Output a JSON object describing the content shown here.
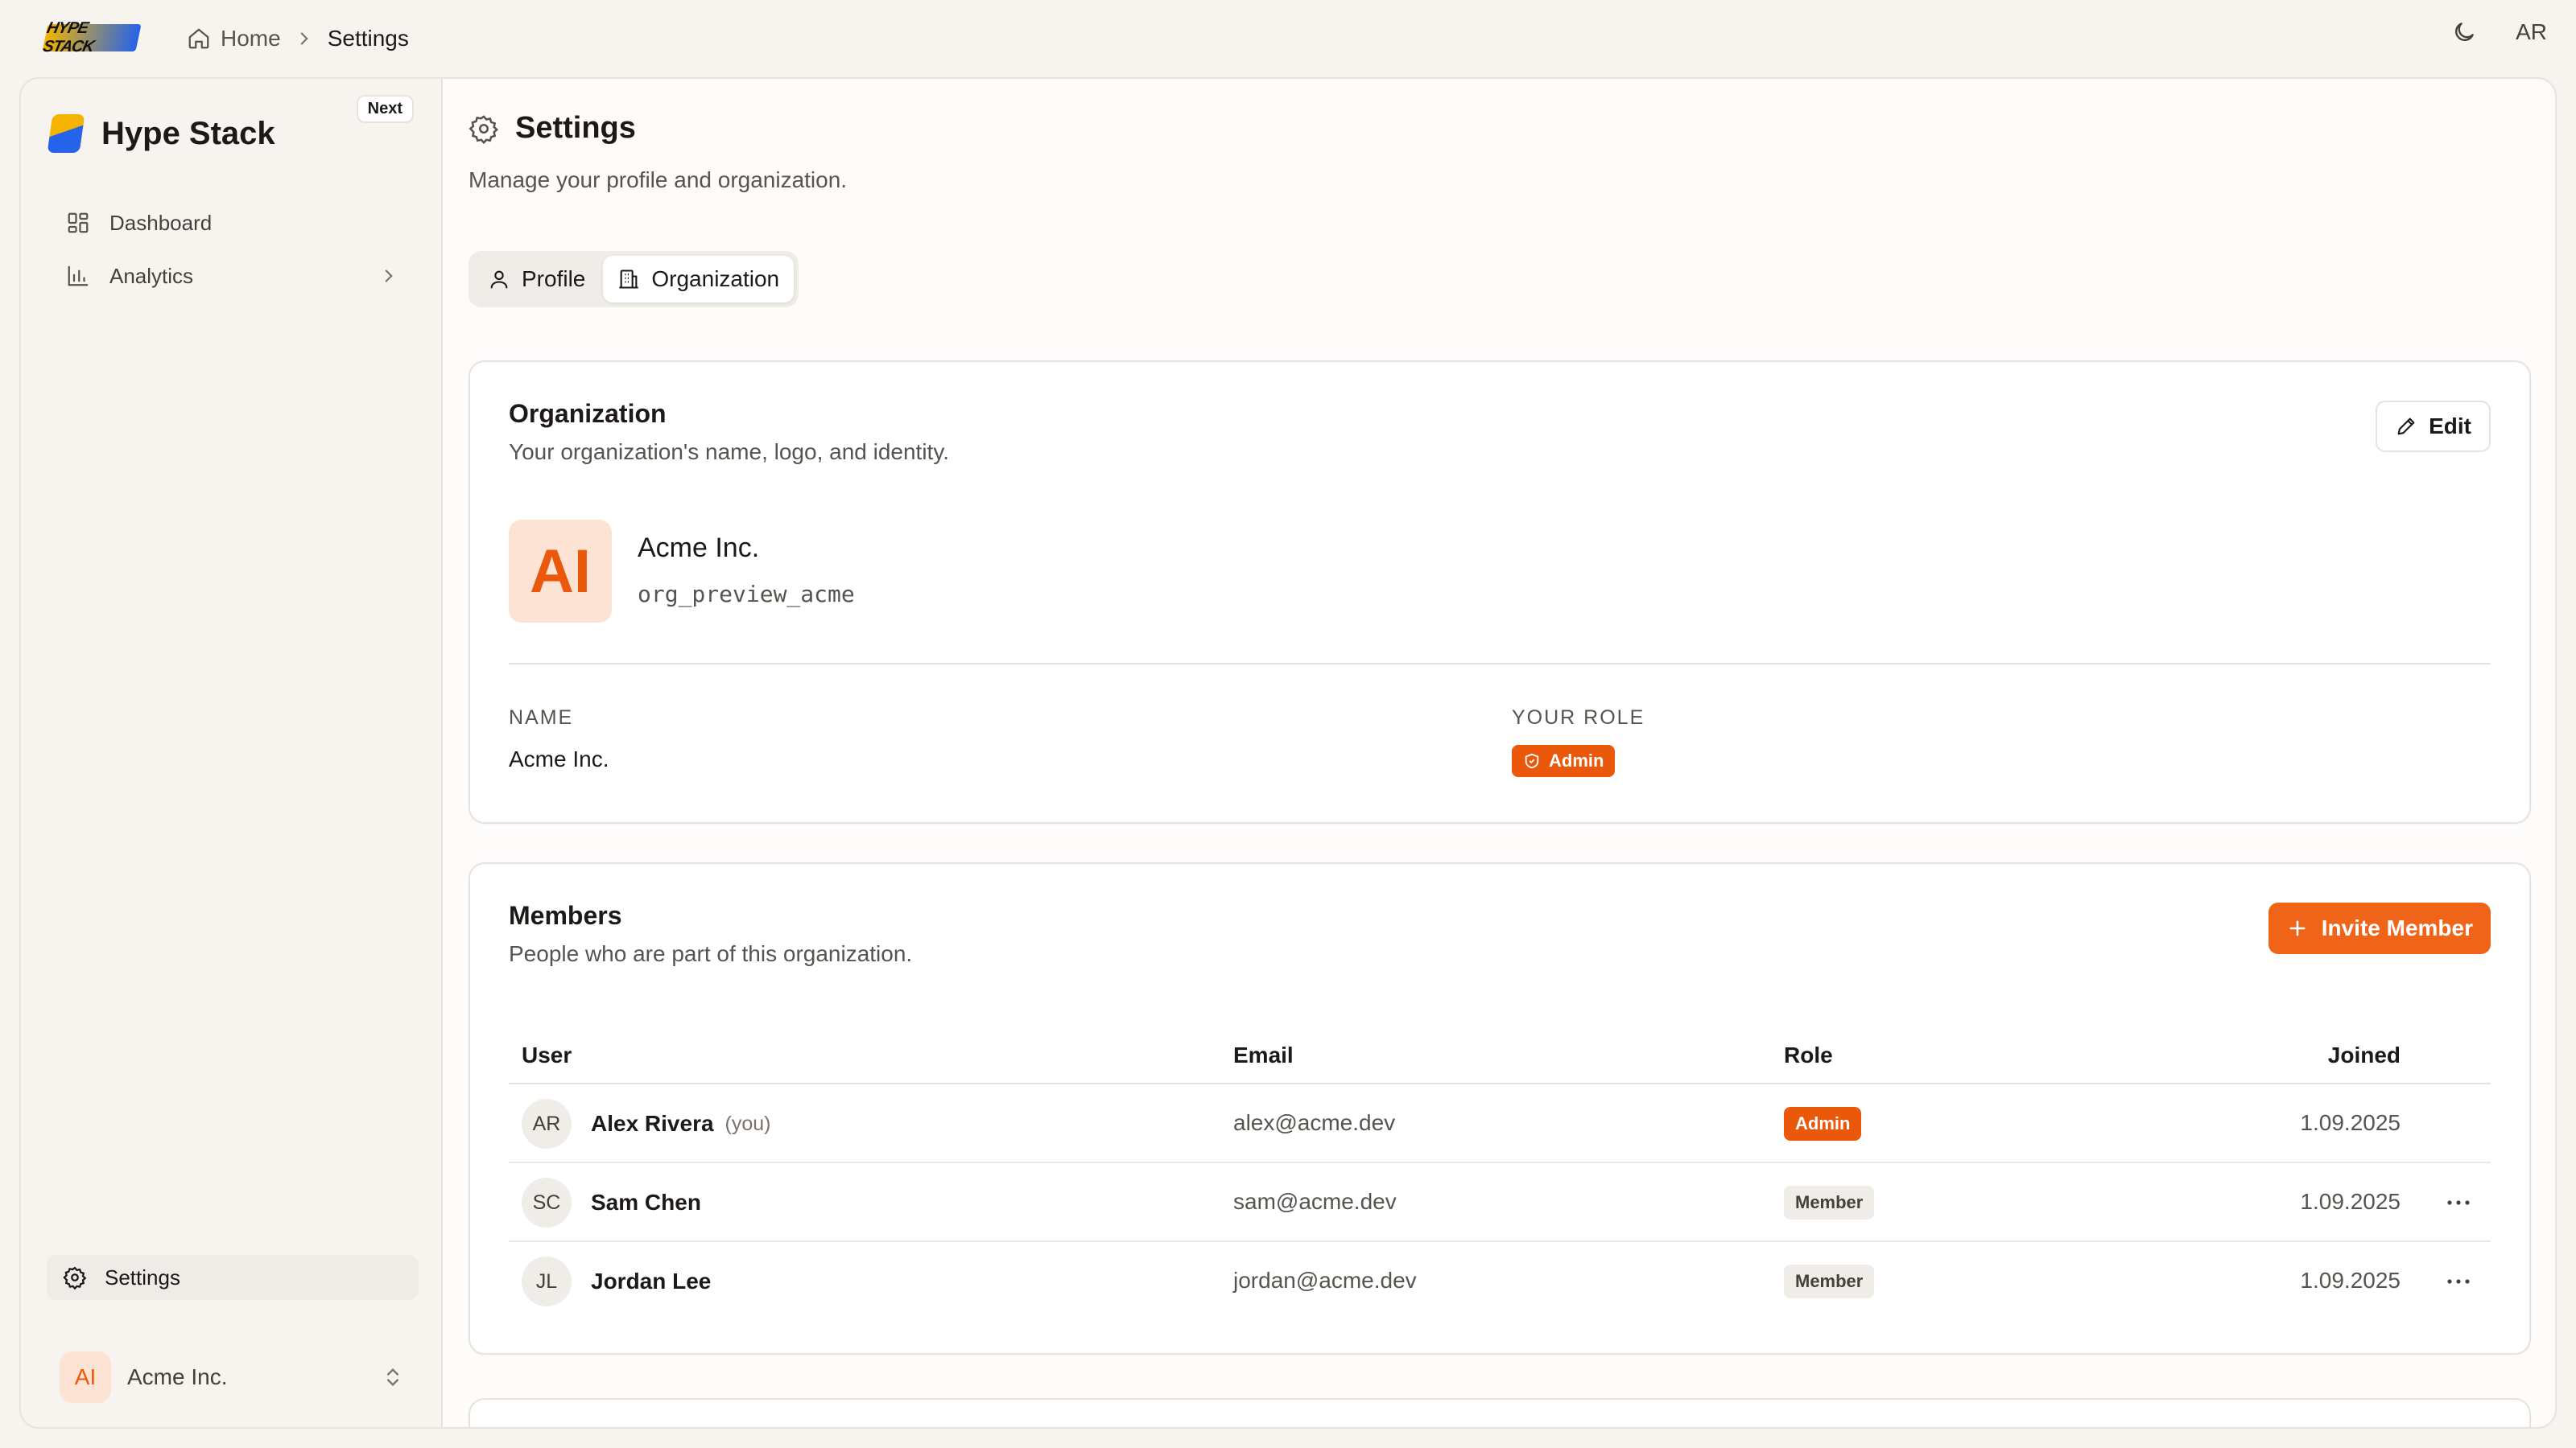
{
  "topbar": {
    "brand_logo_text": "HYPE STACK",
    "breadcrumb": {
      "home": "Home",
      "current": "Settings"
    },
    "user_initials": "AR"
  },
  "sidebar": {
    "title": "Hype Stack",
    "badge": "Next",
    "items": [
      {
        "label": "Dashboard",
        "icon": "dashboard-icon"
      },
      {
        "label": "Analytics",
        "icon": "bar-chart-icon"
      }
    ],
    "settings_label": "Settings",
    "org_switcher": {
      "initials": "AI",
      "name": "Acme Inc."
    }
  },
  "page": {
    "title": "Settings",
    "subtitle": "Manage your profile and organization.",
    "tabs": [
      {
        "label": "Profile",
        "active": false
      },
      {
        "label": "Organization",
        "active": true
      }
    ]
  },
  "organization_card": {
    "title": "Organization",
    "subtitle": "Your organization's name, logo, and identity.",
    "edit_label": "Edit",
    "logo_initials": "AI",
    "name": "Acme Inc.",
    "slug": "org_preview_acme",
    "fields": {
      "name_label": "NAME",
      "name_value": "Acme Inc.",
      "role_label": "YOUR ROLE",
      "role_value": "Admin"
    }
  },
  "members_card": {
    "title": "Members",
    "subtitle": "People who are part of this organization.",
    "invite_label": "Invite Member",
    "columns": {
      "user": "User",
      "email": "Email",
      "role": "Role",
      "joined": "Joined"
    },
    "rows": [
      {
        "initials": "AR",
        "name": "Alex Rivera",
        "you": "(you)",
        "email": "alex@acme.dev",
        "role": "Admin",
        "joined": "1.09.2025"
      },
      {
        "initials": "SC",
        "name": "Sam Chen",
        "you": "",
        "email": "sam@acme.dev",
        "role": "Member",
        "joined": "1.09.2025"
      },
      {
        "initials": "JL",
        "name": "Jordan Lee",
        "you": "",
        "email": "jordan@acme.dev",
        "role": "Member",
        "joined": "1.09.2025"
      }
    ]
  },
  "colors": {
    "accent": "#ea580c",
    "accent_button": "#f0641a",
    "accent_soft": "#fde3d3",
    "background": "#f7f4f0",
    "border": "#e7e2dc"
  }
}
